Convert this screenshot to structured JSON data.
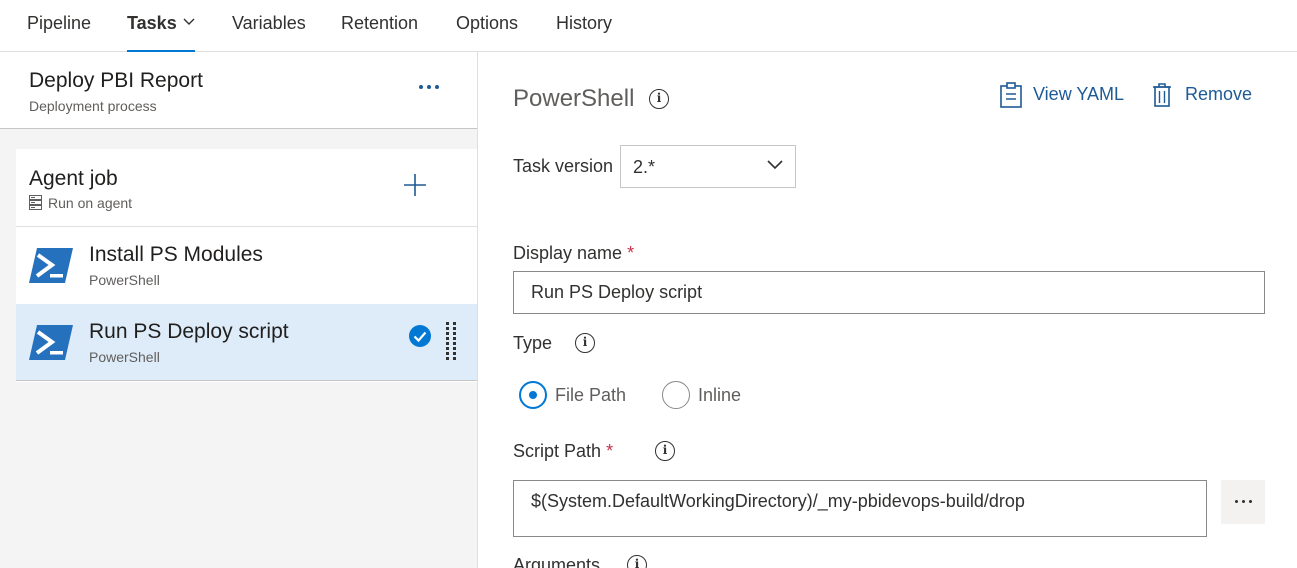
{
  "tabs": [
    {
      "label": "Pipeline"
    },
    {
      "label": "Tasks"
    },
    {
      "label": "Variables"
    },
    {
      "label": "Retention"
    },
    {
      "label": "Options"
    },
    {
      "label": "History"
    }
  ],
  "process": {
    "title": "Deploy PBI Report",
    "subtitle": "Deployment process"
  },
  "agent_job": {
    "title": "Agent job",
    "subtitle": "Run on agent"
  },
  "tasks": [
    {
      "name": "Install PS Modules",
      "type": "PowerShell"
    },
    {
      "name": "Run PS Deploy script",
      "type": "PowerShell",
      "selected": true
    }
  ],
  "detail": {
    "title": "PowerShell",
    "view_yaml": "View YAML",
    "remove": "Remove",
    "task_version_label": "Task version",
    "task_version_value": "2.*",
    "display_name_label": "Display name",
    "required_mark": "*",
    "display_name_value": "Run PS Deploy script",
    "type_label": "Type",
    "type_options": [
      "File Path",
      "Inline"
    ],
    "type_selected": "File Path",
    "script_path_label": "Script Path",
    "script_path_value": "$(System.DefaultWorkingDirectory)/_my-pbidevops-build/drop",
    "arguments_label": "Arguments",
    "info_glyph": "i"
  },
  "colors": {
    "accent": "#0078d4",
    "link": "#1e5a96",
    "selected_row": "#deecf9",
    "required": "#c4314b",
    "powershell_icon": "#2671be"
  }
}
